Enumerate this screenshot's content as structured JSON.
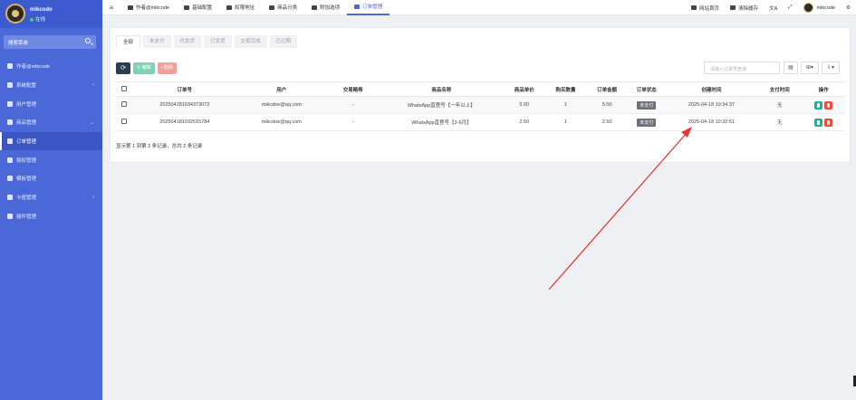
{
  "sidebar": {
    "username": "mikcodo",
    "status": "在线",
    "search_placeholder": "搜索菜单",
    "items": [
      {
        "label": "作者@mikcode",
        "has_arrow": false,
        "active": false
      },
      {
        "label": "系统配置",
        "has_arrow": true,
        "active": false
      },
      {
        "label": "用户管理",
        "has_arrow": false,
        "active": false
      },
      {
        "label": "商品管理",
        "has_arrow": true,
        "active": false
      },
      {
        "label": "订单管理",
        "has_arrow": false,
        "active": true
      },
      {
        "label": "授权管理",
        "has_arrow": false,
        "active": false
      },
      {
        "label": "模板管理",
        "has_arrow": false,
        "active": false
      },
      {
        "label": "卡密管理",
        "has_arrow": true,
        "active": false
      },
      {
        "label": "插件管理",
        "has_arrow": false,
        "active": false
      }
    ]
  },
  "topnav": {
    "items": [
      "作者@mikcode",
      "基础配置",
      "权限地址",
      "商品分类",
      "附加选项",
      "订单管理"
    ],
    "active_index": 5,
    "right": {
      "home": "网站首页",
      "clear_cache": "清除缓存",
      "user": "mikcode"
    }
  },
  "tabs": [
    "全部",
    "未支付",
    "代发货",
    "已发货",
    "交易完成",
    "已过期"
  ],
  "toolbar": {
    "edit_label": "编辑",
    "delete_label": "删除",
    "search_placeholder": "请输入订单号查询"
  },
  "table": {
    "columns": [
      "订单号",
      "用户",
      "交易略希",
      "商品名称",
      "商品单价",
      "购买数量",
      "订单金额",
      "订单状态",
      "创建时间",
      "支付时间",
      "操作"
    ],
    "rows": [
      [
        "202504181034373072",
        "mikcdoe@qq.com",
        "-",
        "WhatsApp直登号【一年以上】",
        "5.00",
        "1",
        "5.00",
        "未支付",
        "2025-04-18 10:34:37",
        "无"
      ],
      [
        "202504181032515784",
        "mikcdoe@qq.com",
        "-",
        "WhatsApp直登号【3-6月】",
        "2.50",
        "1",
        "2.50",
        "未支付",
        "2025-04-18 10:32:51",
        "无"
      ]
    ]
  },
  "pager": "显示第 1 到第 2 条记录，总共 2 条记录",
  "colors": {
    "sidebar": "#4a68d8",
    "annotation_arrow": "#e53935"
  }
}
